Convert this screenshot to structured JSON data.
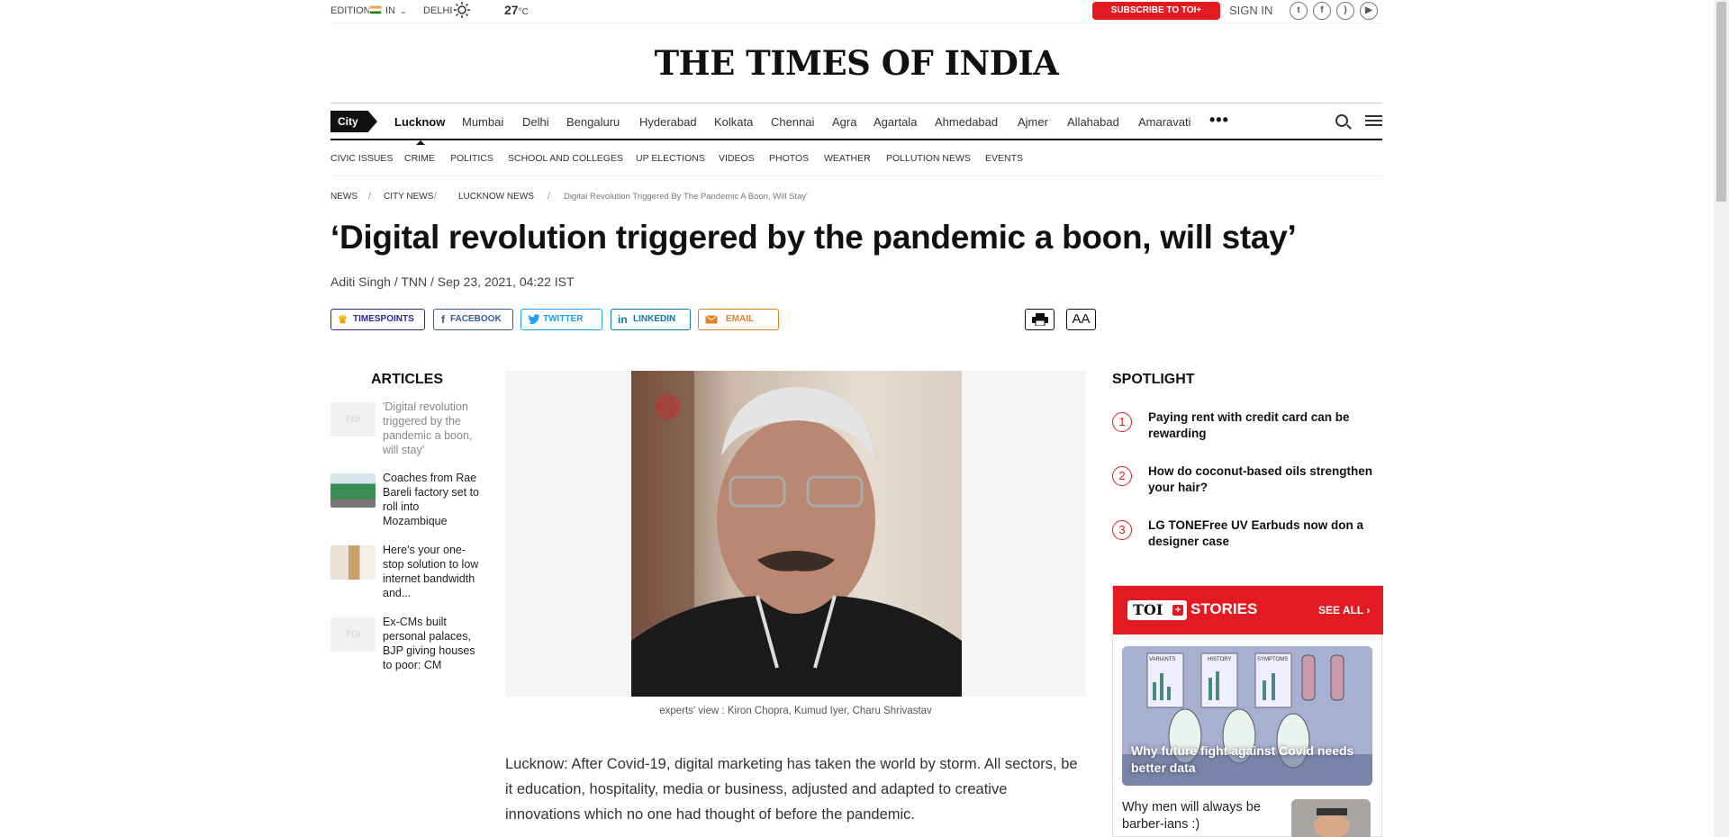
{
  "topbar": {
    "edition_label": "EDITION",
    "edition_value": "IN",
    "city": "DELHI",
    "temperature": "27",
    "temp_unit": "°C",
    "subscribe_label": "SUBSCRIBE TO TOI+",
    "signin_label": "SIGN IN",
    "social": [
      "twitter-icon",
      "facebook-icon",
      "rss-icon",
      "youtube-icon"
    ]
  },
  "masthead": {
    "title": "THE TIMES OF INDIA"
  },
  "city_nav": {
    "tag": "City",
    "items": [
      "Lucknow",
      "Mumbai",
      "Delhi",
      "Bengaluru",
      "Hyderabad",
      "Kolkata",
      "Chennai",
      "Agra",
      "Agartala",
      "Ahmedabad",
      "Ajmer",
      "Allahabad",
      "Amaravati"
    ],
    "active": "Lucknow",
    "more": "•••"
  },
  "sub_nav": [
    "CIVIC ISSUES",
    "CRIME",
    "POLITICS",
    "SCHOOL AND COLLEGES",
    "UP ELECTIONS",
    "VIDEOS",
    "PHOTOS",
    "WEATHER",
    "POLLUTION NEWS",
    "EVENTS"
  ],
  "breadcrumb": [
    "NEWS",
    "CITY NEWS",
    "LUCKNOW NEWS",
    "Digital Revolution Triggered By The Pandemic A Boon, Will Stay'"
  ],
  "article": {
    "headline": "‘Digital revolution triggered by the pandemic a boon, will stay’",
    "byline": "Aditi Singh / TNN / Sep 23, 2021, 04:22 IST",
    "caption": "experts' view : Kiron Chopra, Kumud Iyer, Charu Shrivastav",
    "body": "Lucknow: After Covid-19, digital marketing has taken the world by storm. All sectors, be it education, hospitality, media or business, adjusted and adapted to creative innovations which no one had thought of before the pandemic."
  },
  "share": {
    "timespoints": "TIMESPOINTS",
    "facebook": "FACEBOOK",
    "twitter": "TWITTER",
    "linkedin": "LINKEDIN",
    "email": "EMAIL",
    "font_tool": "AA"
  },
  "articles": {
    "heading": "ARTICLES",
    "thumb_text": "TOI",
    "items": [
      "'Digital revolution triggered by the pandemic a boon, will stay'",
      "Coaches from Rae Bareli factory set to roll into Mozambique",
      "Here's your one-stop solution to low internet bandwidth and...",
      "Ex-CMs built personal palaces, BJP giving houses to poor: CM"
    ]
  },
  "spotlight": {
    "heading": "SPOTLIGHT",
    "items": [
      {
        "num": "1",
        "text": "Paying rent with credit card can be rewarding"
      },
      {
        "num": "2",
        "text": "How do coconut-based oils strengthen your hair?"
      },
      {
        "num": "3",
        "text": "LG TONEFree UV Earbuds now don a designer case"
      }
    ]
  },
  "stories": {
    "logo": "TOI",
    "plus": "+",
    "title": "STORIES",
    "see_all": "SEE ALL ›",
    "card1": "Why future fight against Covid needs better data",
    "card1_labels": [
      "VARIANTS",
      "HISTORY",
      "SYMPTOMS"
    ],
    "card2": "Why men will always be barber-ians :)"
  },
  "colors": {
    "brand_red": "#e21b22",
    "facebook": "#3b5998",
    "twitter": "#1da1f2",
    "linkedin": "#0e76a8",
    "email": "#e8801d",
    "timespoints": "#2a2a9c"
  }
}
